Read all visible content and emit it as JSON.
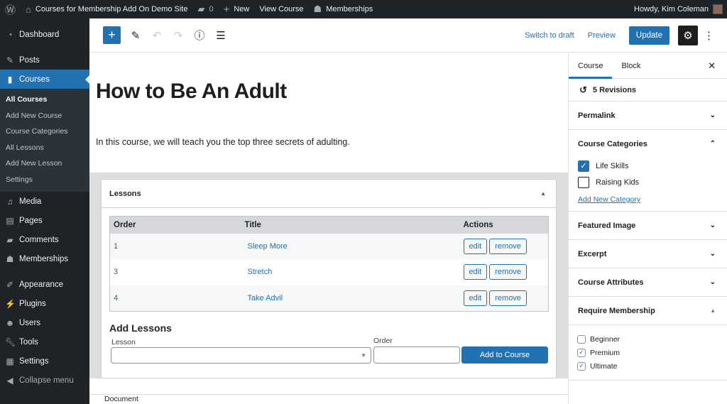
{
  "admin_bar": {
    "site_name": "Courses for Membership Add On Demo Site",
    "comments_count": "0",
    "new_label": "New",
    "view_label": "View Course",
    "memberships_label": "Memberships",
    "greeting": "Howdy, Kim Coleman"
  },
  "sidebar": {
    "items": [
      {
        "label": "Dashboard",
        "icon": "dashboard-icon"
      },
      {
        "label": "Posts",
        "icon": "pin-icon"
      },
      {
        "label": "Courses",
        "icon": "book-icon"
      },
      {
        "label": "Media",
        "icon": "media-icon"
      },
      {
        "label": "Pages",
        "icon": "pages-icon"
      },
      {
        "label": "Comments",
        "icon": "comment-icon"
      },
      {
        "label": "Memberships",
        "icon": "groups-icon"
      },
      {
        "label": "Appearance",
        "icon": "brush-icon"
      },
      {
        "label": "Plugins",
        "icon": "plugin-icon"
      },
      {
        "label": "Users",
        "icon": "user-icon"
      },
      {
        "label": "Tools",
        "icon": "wrench-icon"
      },
      {
        "label": "Settings",
        "icon": "settings-icon"
      }
    ],
    "courses_submenu": [
      "All Courses",
      "Add New Course",
      "Course Categories",
      "All Lessons",
      "Add New Lesson",
      "Settings"
    ],
    "collapse_label": "Collapse menu"
  },
  "toolbar": {
    "switch_draft": "Switch to draft",
    "preview": "Preview",
    "update": "Update"
  },
  "post": {
    "title": "How to Be An Adult",
    "description": "In this course, we will teach you the top three secrets of adulting."
  },
  "lessons_box": {
    "title": "Lessons",
    "columns": [
      "Order",
      "Title",
      "Actions"
    ],
    "rows": [
      {
        "order": "1",
        "title": "Sleep More"
      },
      {
        "order": "3",
        "title": "Stretch"
      },
      {
        "order": "4",
        "title": "Take Advil"
      }
    ],
    "edit_label": "edit",
    "remove_label": "remove",
    "add_title": "Add Lessons",
    "lesson_label": "Lesson",
    "order_label": "Order",
    "lesson_value": "",
    "order_value": "",
    "add_button": "Add to Course"
  },
  "footer": {
    "breadcrumb": "Document"
  },
  "settings": {
    "tabs": [
      "Course",
      "Block"
    ],
    "revisions": "5 Revisions",
    "panels": {
      "permalink": "Permalink",
      "categories": "Course Categories",
      "featured": "Featured Image",
      "excerpt": "Excerpt",
      "attributes": "Course Attributes",
      "membership": "Require Membership"
    },
    "categories": [
      {
        "label": "Life Skills",
        "checked": true
      },
      {
        "label": "Raising Kids",
        "checked": false
      }
    ],
    "add_category": "Add New Category",
    "memberships": [
      {
        "label": "Beginner",
        "checked": false
      },
      {
        "label": "Premium",
        "checked": true
      },
      {
        "label": "Ultimate",
        "checked": true
      }
    ]
  }
}
